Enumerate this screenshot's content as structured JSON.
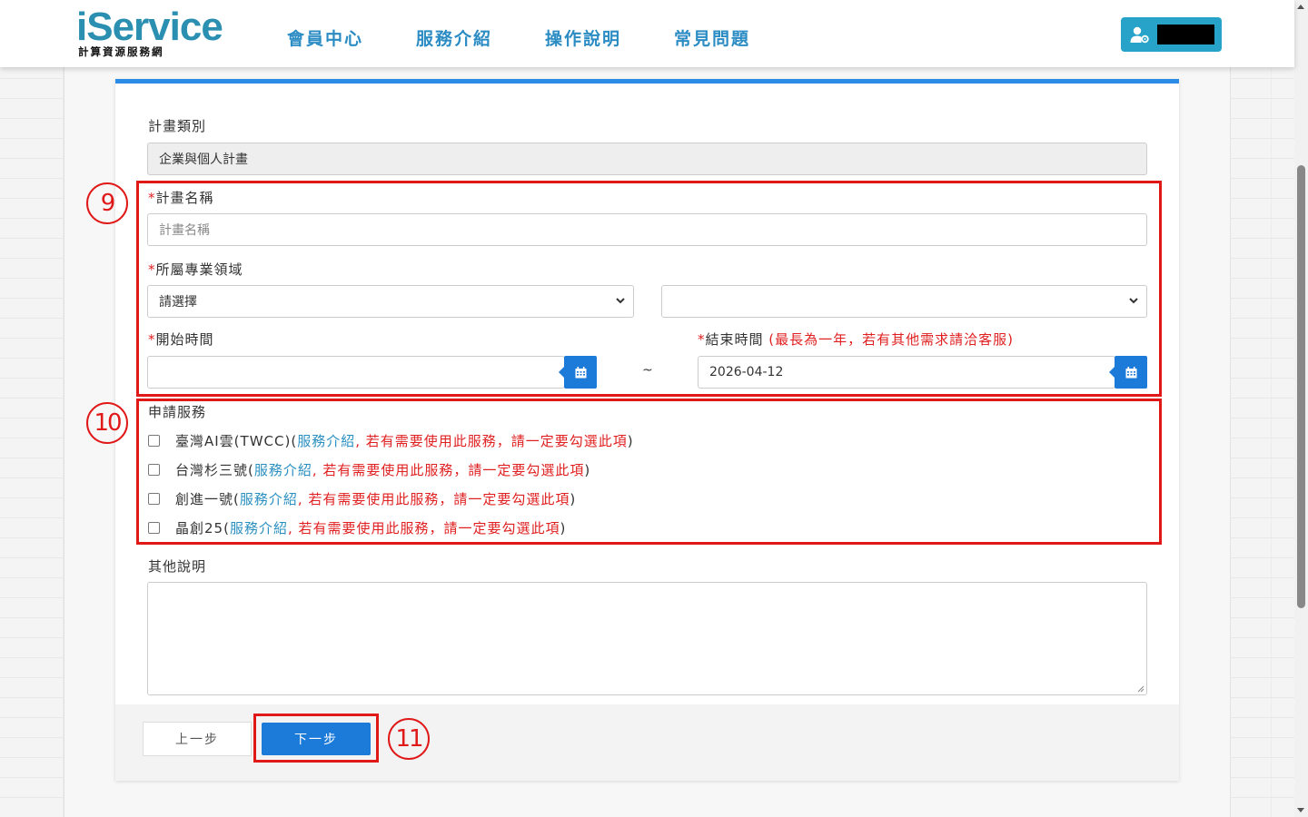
{
  "header": {
    "logo_main": "iService",
    "logo_sub": "計算資源服務網",
    "nav": [
      "會員中心",
      "服務介紹",
      "操作說明",
      "常見問題"
    ],
    "user_icon": "user-gear-icon"
  },
  "form": {
    "plan_type": {
      "label": "計畫類別",
      "value": "企業與個人計畫"
    },
    "plan_name": {
      "required_mark": "*",
      "label": "計畫名稱",
      "placeholder": "計畫名稱"
    },
    "field": {
      "required_mark": "*",
      "label": "所屬專業領域",
      "select1_value": "請選擇",
      "select2_value": ""
    },
    "start_time": {
      "required_mark": "*",
      "label": "開始時間",
      "value": ""
    },
    "range_sep": "~",
    "end_time": {
      "required_mark": "*",
      "label": "結束時間",
      "note": "(最長為一年，若有其他需求請洽客服)",
      "value": "2026-04-12"
    },
    "services": {
      "label": "申請服務",
      "items": [
        {
          "name": "臺灣AI雲(TWCC)(",
          "link": "服務介紹",
          "note": ", 若有需要使用此服務，請一定要勾選此項",
          "close": ")"
        },
        {
          "name": "台灣杉三號(",
          "link": "服務介紹",
          "note": ", 若有需要使用此服務，請一定要勾選此項",
          "close": ")"
        },
        {
          "name": "創進一號(",
          "link": "服務介紹",
          "note": ", 若有需要使用此服務，請一定要勾選此項",
          "close": ")"
        },
        {
          "name": "晶創25(",
          "link": "服務介紹",
          "note": ", 若有需要使用此服務，請一定要勾選此項",
          "close": ")"
        }
      ]
    },
    "other": {
      "label": "其他說明",
      "value": ""
    }
  },
  "buttons": {
    "prev": "上一步",
    "next": "下一步"
  },
  "annotations": {
    "step9": "9",
    "step10": "10",
    "step11": "11"
  },
  "colors": {
    "accent": "#1c7ad8",
    "highlight": "#e01818",
    "brand": "#2a8fb0"
  }
}
